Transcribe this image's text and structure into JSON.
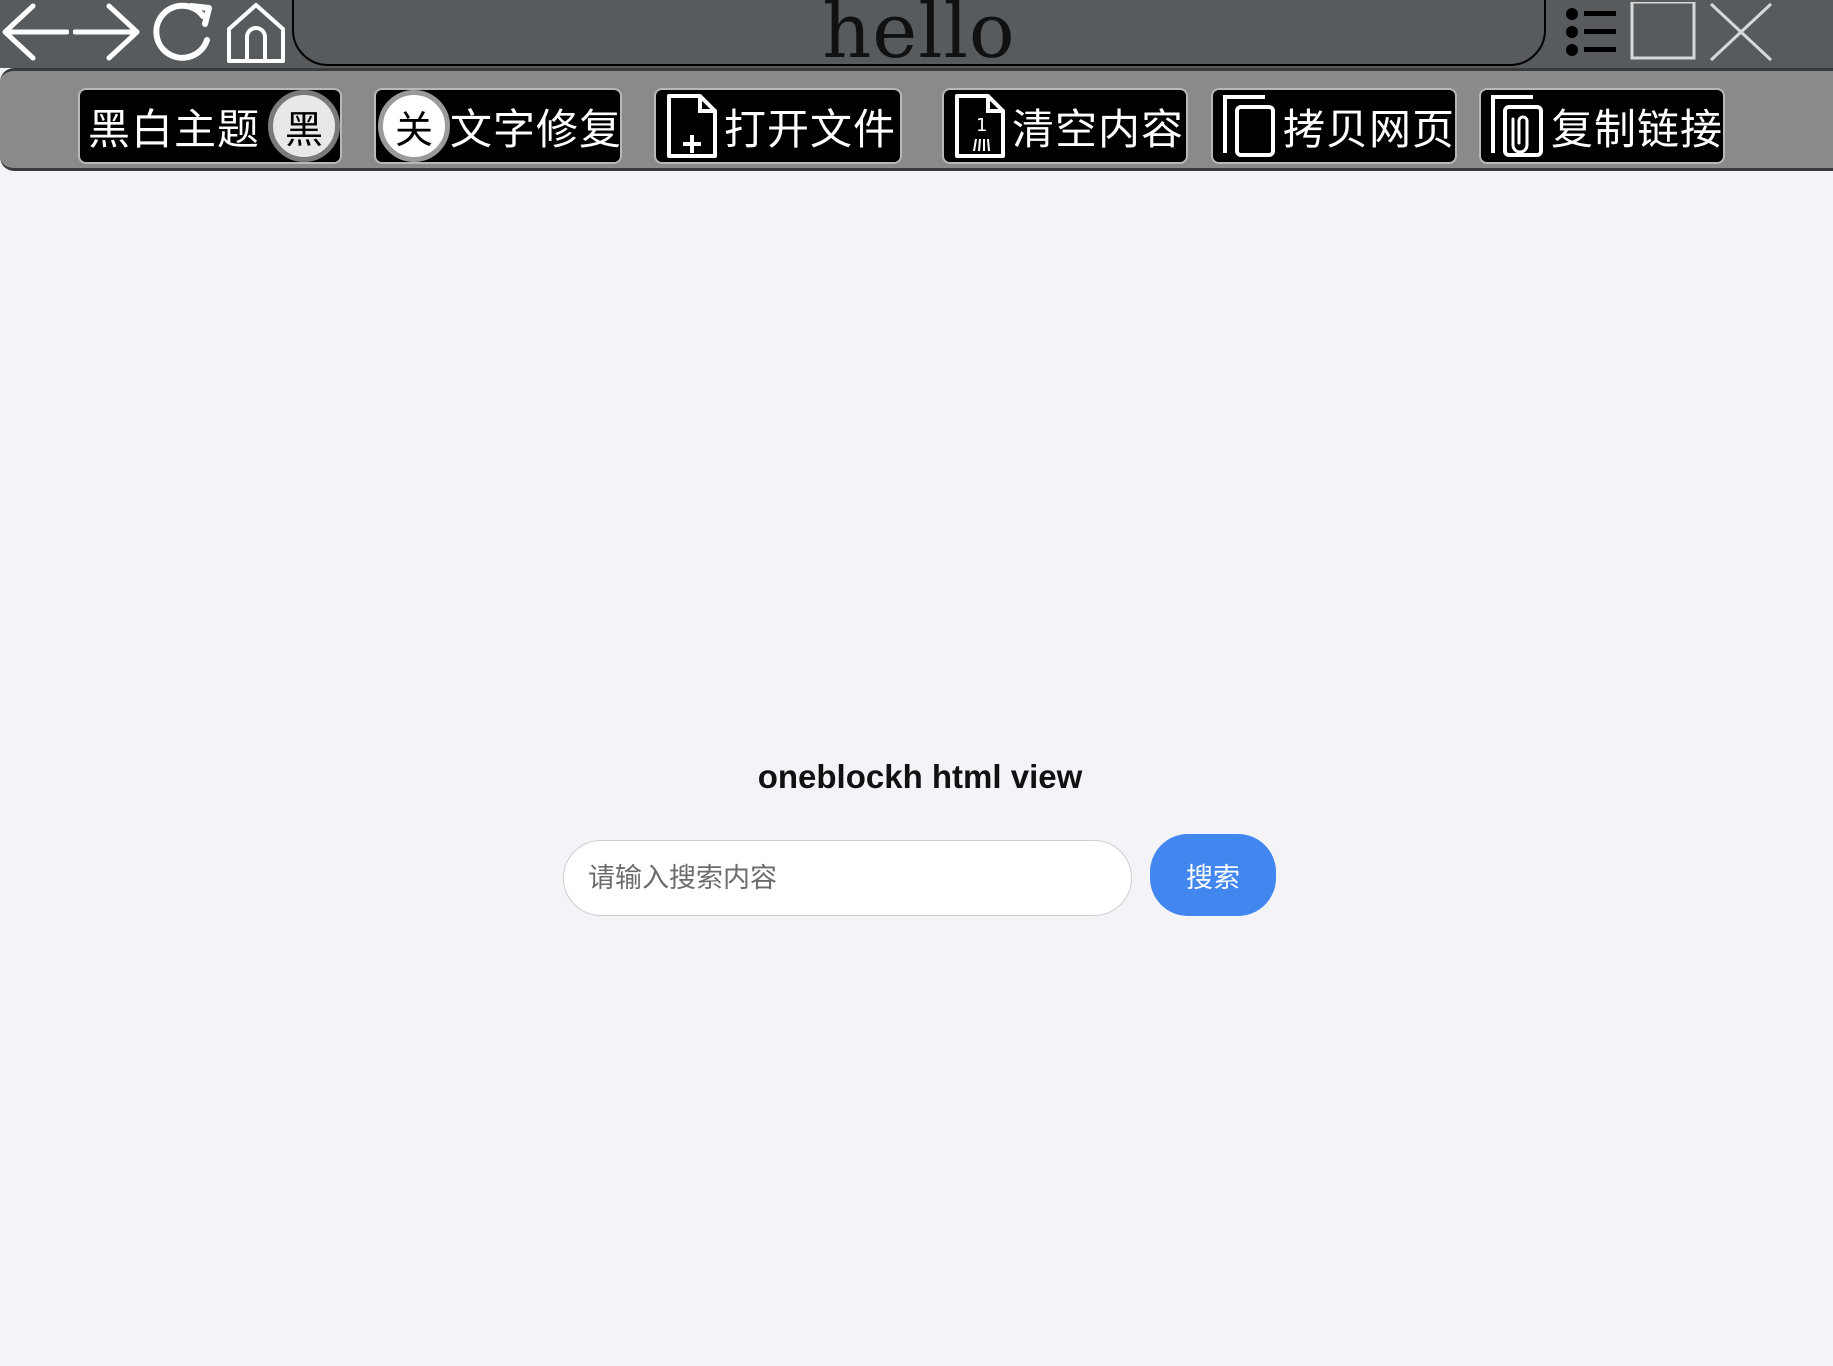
{
  "titlebar": {
    "address_text": "hello",
    "icons": [
      "back-arrow-icon",
      "forward-arrow-icon",
      "reload-icon",
      "home-icon",
      "menu-list-icon",
      "maximize-icon",
      "close-icon"
    ]
  },
  "toolbar": {
    "theme_toggle": {
      "label": "黑白主题",
      "state": "黑"
    },
    "text_fix_toggle": {
      "state": "关",
      "label": "文字修复"
    },
    "open_file": {
      "label": "打开文件",
      "icon": "file-plus-icon"
    },
    "clear_content": {
      "label": "清空内容",
      "icon": "file-clear-icon",
      "icon_glyph": "1"
    },
    "copy_page": {
      "label": "拷贝网页",
      "icon": "copy-page-icon"
    },
    "copy_link": {
      "label": "复制链接",
      "icon": "paperclip-icon"
    }
  },
  "main": {
    "title": "oneblockh html view",
    "search": {
      "placeholder": "请输入搜索内容",
      "value": "",
      "button_label": "搜索"
    }
  },
  "colors": {
    "titlebar_bg": "#575b5e",
    "toolbar_bg": "#8a8a8a",
    "page_bg": "#f4f4f8",
    "accent": "#4286f0"
  }
}
